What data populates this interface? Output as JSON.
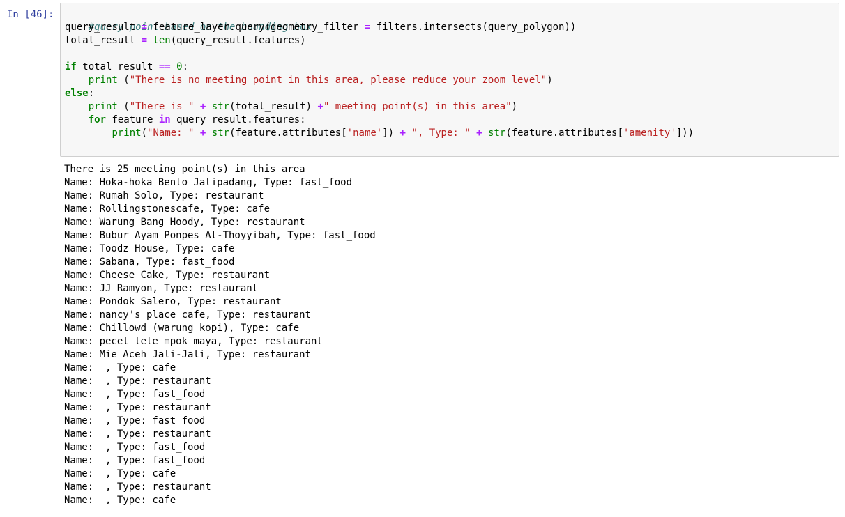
{
  "cell": {
    "prompt": "In [46]:",
    "code": {
      "comment": "#query point based on the bounding box",
      "line2": {
        "var": "query_result",
        "eq": " = ",
        "call": "feature_layer.query(geometry_filter ",
        "eq2": "=",
        "rest": " filters.intersects(query_polygon))"
      },
      "line3": {
        "var": "total_result ",
        "eq": "=",
        "sp": " ",
        "fn": "len",
        "rest": "(query_result.features)"
      },
      "line5": {
        "kw": "if",
        "a": " total_result ",
        "op": "==",
        "sp": " ",
        "num": "0",
        "colon": ":"
      },
      "line6": {
        "indent": "    ",
        "fn": "print",
        "open": " (",
        "str": "\"There is no meeting point in this area, please reduce your zoom level\"",
        "close": ")"
      },
      "line7": {
        "kw": "else",
        "colon": ":"
      },
      "line8": {
        "indent": "    ",
        "fn": "print",
        "open": " (",
        "str1": "\"There is \"",
        "sp1": " ",
        "op1": "+",
        "sp2": " ",
        "fn2": "str",
        "mid": "(total_result) ",
        "op2": "+",
        "str2": "\" meeting point(s) in this area\"",
        "close": ")"
      },
      "line9": {
        "indent": "    ",
        "kw": "for",
        "a": " feature ",
        "kw2": "in",
        "rest": " query_result.features:"
      },
      "line10": {
        "indent": "        ",
        "fn": "print",
        "open": "(",
        "str1": "\"Name: \"",
        "sp1": " ",
        "op1": "+",
        "sp2": " ",
        "fn2": "str",
        "a1": "(feature.attributes[",
        "str2": "'name'",
        "a2": "]) ",
        "op2": "+",
        "sp3": " ",
        "str3": "\", Type: \"",
        "sp4": " ",
        "op3": "+",
        "sp5": " ",
        "fn3": "str",
        "a3": "(feature.attributes[",
        "str4": "'amenity'",
        "a4": "]))"
      }
    },
    "output": [
      "There is 25 meeting point(s) in this area",
      "Name: Hoka-hoka Bento Jatipadang, Type: fast_food",
      "Name: Rumah Solo, Type: restaurant",
      "Name: Rollingstonescafe, Type: cafe",
      "Name: Warung Bang Hoody, Type: restaurant",
      "Name: Bubur Ayam Ponpes At-Thoyyibah, Type: fast_food",
      "Name: Toodz House, Type: cafe",
      "Name: Sabana, Type: fast_food",
      "Name: Cheese Cake, Type: restaurant",
      "Name: JJ Ramyon, Type: restaurant",
      "Name: Pondok Salero, Type: restaurant",
      "Name: nancy's place cafe, Type: restaurant",
      "Name: Chillowd (warung kopi), Type: cafe",
      "Name: pecel lele mpok maya, Type: restaurant",
      "Name: Mie Aceh Jali-Jali, Type: restaurant",
      "Name:  , Type: cafe",
      "Name:  , Type: restaurant",
      "Name:  , Type: fast_food",
      "Name:  , Type: restaurant",
      "Name:  , Type: fast_food",
      "Name:  , Type: restaurant",
      "Name:  , Type: fast_food",
      "Name:  , Type: fast_food",
      "Name:  , Type: cafe",
      "Name:  , Type: restaurant",
      "Name:  , Type: cafe"
    ]
  },
  "colors": {
    "prompt": "#303F9F",
    "input_bg": "#f7f7f7",
    "input_border": "#cfcfcf",
    "comment": "#408080",
    "keyword": "#008000",
    "operator": "#AA22FF",
    "string": "#BA2121"
  }
}
